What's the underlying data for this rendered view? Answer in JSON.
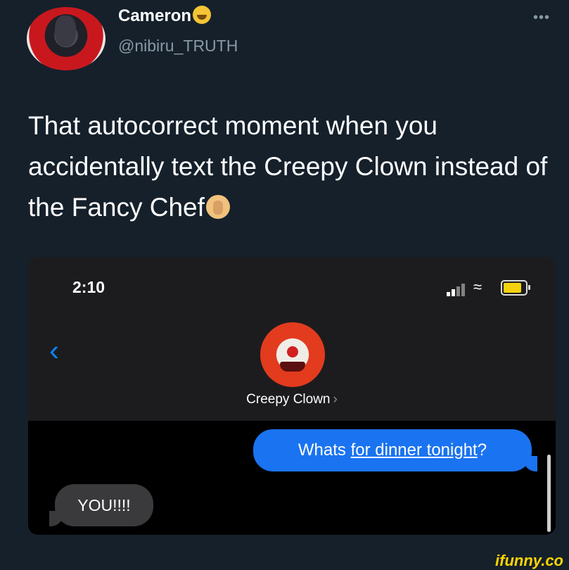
{
  "tweet": {
    "display_name": "Cameron",
    "handle": "@nibiru_TRUTH",
    "more_label": "•••",
    "text": "That autocorrect moment when you accidentally text the Creepy Clown instead of the Fancy Chef",
    "name_emoji": "smiling-face-emoji",
    "text_emoji": "facepalm-emoji"
  },
  "phone": {
    "status_time": "2:10",
    "back_label": "‹",
    "contact_name": "Creepy Clown",
    "contact_chevron": "›",
    "messages": [
      {
        "direction": "sent",
        "text_prefix": "Whats ",
        "text_link": "for dinner tonight",
        "text_suffix": "?"
      },
      {
        "direction": "received",
        "text": "YOU!!!!"
      }
    ]
  },
  "watermark": "ifunny.co",
  "colors": {
    "background": "#15202b",
    "sent_bubble": "#1a73f0",
    "received_bubble": "#3a3a3c",
    "accent": "#0a84ff",
    "watermark": "#ffd400"
  }
}
